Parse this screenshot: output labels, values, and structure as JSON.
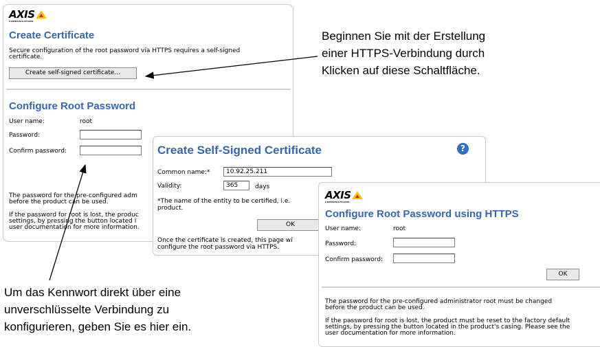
{
  "panel1": {
    "logo": "AXIS",
    "logo_sub": "COMMUNICATIONS",
    "create_cert_title": "Create Certificate",
    "create_cert_desc_1": "Secure configuration of the root password via HTTPS requires a self-signed",
    "create_cert_desc_2": "certificate.",
    "create_cert_button": "Create self-signed certificate...",
    "root_pw_title": "Configure Root Password",
    "user_name_label": "User name:",
    "user_name_value": "root",
    "password_label": "Password:",
    "password_value": "",
    "confirm_label": "Confirm password:",
    "confirm_value": "",
    "note1_line1": "The password for the pre-configured adm",
    "note1_line2": "before the product can be used.",
    "note2_line1": "If the password for root is lost, the produc",
    "note2_line2": "settings, by pressing the button located i",
    "note2_line3": "user documentation for more information."
  },
  "panel2": {
    "title": "Create Self-Signed Certificate",
    "common_name_label": "Common name:*",
    "common_name_value": "10.92.25.211",
    "validity_label": "Validity:",
    "validity_value": "365",
    "validity_unit": "days",
    "footnote_line1": "*The name of the entity to be certified, i.e.",
    "footnote_line2": "product.",
    "ok_button": "OK",
    "info_line1": "Once the certificate is created, this page wi",
    "info_line2": "configure the root password via HTTPS.",
    "help_icon": "?"
  },
  "panel3": {
    "logo": "AXIS",
    "logo_sub": "COMMUNICATIONS",
    "title": "Configure Root Password using HTTPS",
    "user_name_label": "User name:",
    "user_name_value": "root",
    "password_label": "Password:",
    "password_value": "",
    "confirm_label": "Confirm password:",
    "confirm_value": "",
    "ok_button": "OK",
    "note1_line1": "The password for the pre-configured administrator root must be changed",
    "note1_line2": "before the product can be used.",
    "note2_line1": "If the password for root is lost, the product must be reset to the factory default",
    "note2_line2": "settings, by pressing the button located in the product's casing. Please see the",
    "note2_line3": "user documentation for more information."
  },
  "callouts": {
    "top_right": [
      "Beginnen Sie mit der Erstellung",
      "einer HTTPS-Verbindung durch",
      "Klicken auf diese Schaltfläche."
    ],
    "bottom_left": [
      "Um das Kennwort direkt über eine",
      "unverschlüsselte Verbindung zu",
      "konfigurieren, geben Sie es hier ein."
    ]
  },
  "colors": {
    "heading": "#3466b4",
    "help_icon": "#2f6fc4",
    "logo_yellow": "#f5c400"
  }
}
